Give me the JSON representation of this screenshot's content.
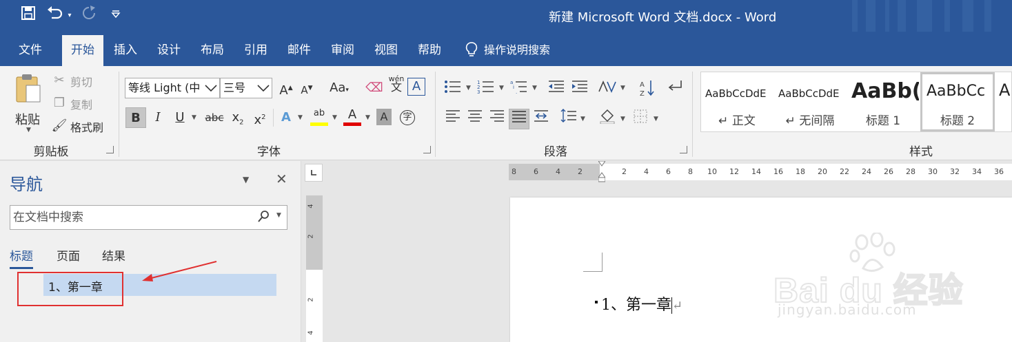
{
  "window": {
    "title": "新建 Microsoft Word 文档.docx  -  Word"
  },
  "qat": {
    "save_icon": "save-icon",
    "undo_icon": "undo-icon",
    "redo_icon": "redo-icon",
    "customize_icon": "customize-qat-icon"
  },
  "tabs": [
    {
      "label": "文件"
    },
    {
      "label": "开始"
    },
    {
      "label": "插入"
    },
    {
      "label": "设计"
    },
    {
      "label": "布局"
    },
    {
      "label": "引用"
    },
    {
      "label": "邮件"
    },
    {
      "label": "审阅"
    },
    {
      "label": "视图"
    },
    {
      "label": "帮助"
    }
  ],
  "active_tab": "开始",
  "tell_me": "操作说明搜索",
  "clipboard": {
    "paste": "粘贴",
    "cut": "剪切",
    "copy": "复制",
    "format_painter": "格式刷",
    "group": "剪贴板"
  },
  "font": {
    "name": "等线 Light (中",
    "size": "三号",
    "group": "字体",
    "grow": "A",
    "shrink": "A",
    "change_case": "Aa",
    "bold": "B",
    "italic": "I",
    "underline": "U",
    "strike": "abc",
    "subscript": "x",
    "superscript": "x",
    "sub_digit": "2",
    "sup_digit": "2",
    "text_effect": "A",
    "highlight": "ab",
    "font_color": "A",
    "char_shading": "A",
    "enclose": "字",
    "phonetic": "wén",
    "phonetic_char": "文",
    "char_border": "A",
    "highlight_color": "#ffff00",
    "font_color_value": "#e00000"
  },
  "paragraph": {
    "group": "段落"
  },
  "styles": {
    "group": "样式",
    "items": [
      {
        "preview": "AaBbCcDdE",
        "name": "正文"
      },
      {
        "preview": "AaBbCcDdE",
        "name": "无间隔"
      },
      {
        "preview": "AaBb(",
        "name": "标题 1"
      },
      {
        "preview": "AaBbCc",
        "name": "标题 2"
      },
      {
        "preview": "A",
        "name": ""
      }
    ]
  },
  "nav": {
    "title": "导航",
    "search_placeholder": "在文档中搜索",
    "tabs": [
      {
        "label": "标题"
      },
      {
        "label": "页面"
      },
      {
        "label": "结果"
      }
    ],
    "headings": [
      {
        "text": "1、第一章"
      }
    ]
  },
  "hruler": {
    "left_ticks": [
      "8",
      "6",
      "4",
      "2"
    ],
    "right_ticks": [
      "2",
      "4",
      "6",
      "8",
      "10",
      "12",
      "14",
      "16",
      "18",
      "20",
      "22",
      "24",
      "26",
      "28",
      "30",
      "32",
      "34",
      "36"
    ]
  },
  "vruler": {
    "ticks": [
      "4",
      "2",
      "2",
      "4"
    ]
  },
  "document": {
    "text": "1、第一章",
    "para_mark": "↵"
  },
  "watermark": {
    "main": "Bai du 经验",
    "sub": "jingyan.baidu.com"
  },
  "colors": {
    "brand": "#2b579a",
    "annotation": "#e03030"
  }
}
